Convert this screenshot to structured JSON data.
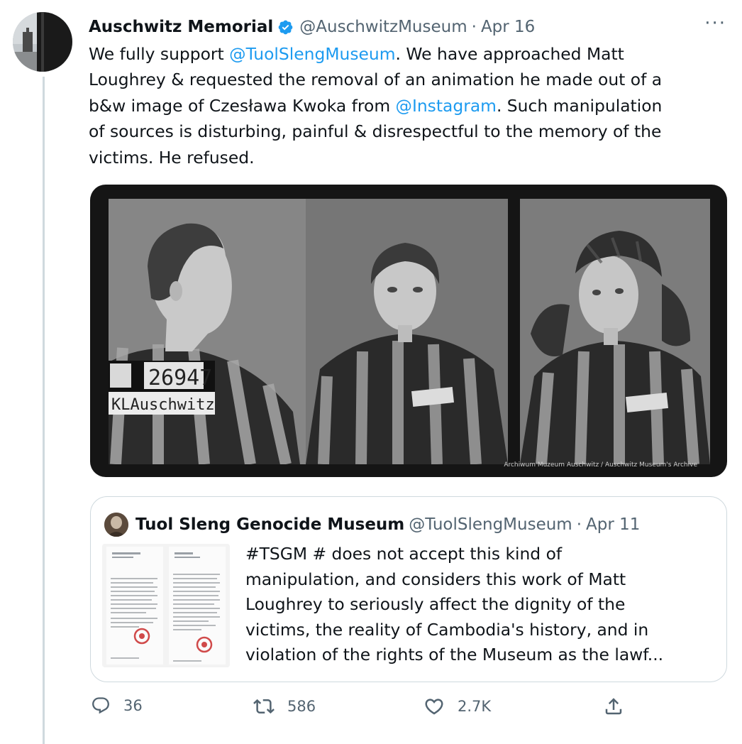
{
  "tweet": {
    "author": "Auschwitz Memorial",
    "handle": "@AuschwitzMuseum",
    "separator": "·",
    "date": "Apr 16",
    "more": "···",
    "text": {
      "p1": "We fully support ",
      "m1": "@TuolSlengMuseum",
      "p2": ". We have approached Matt\nLoughrey & requested the removal of an animation he made out of a\nb&w image of Czesława Kwoka from ",
      "m2": "@Instagram",
      "p3": ". Such manipulation\nof sources is disturbing, painful & disrespectful to the memory of the\nvictims. He refused."
    },
    "photo": {
      "plate_number": "26947",
      "plate_label": "KLAuschwitz",
      "credit": "Archiwum Muzeum Auschwitz / Auschwitz Museum's Archive"
    }
  },
  "quote": {
    "author": "Tuol Sleng Genocide Museum",
    "handle": "@TuolSlengMuseum",
    "separator": "·",
    "date": "Apr 11",
    "text": "#TSGM # does not accept this kind of\nmanipulation, and considers this work of Matt\nLoughrey to seriously affect the dignity of the\nvictims, the reality of Cambodia's history, and in\nviolation of the rights of the Museum as the lawf..."
  },
  "actions": {
    "replies": "36",
    "retweets": "586",
    "likes": "2.7K"
  },
  "colors": {
    "link": "#1d9bf0",
    "secondary": "#536471",
    "border": "#cfd9de",
    "verified": "#1d9bf0"
  }
}
